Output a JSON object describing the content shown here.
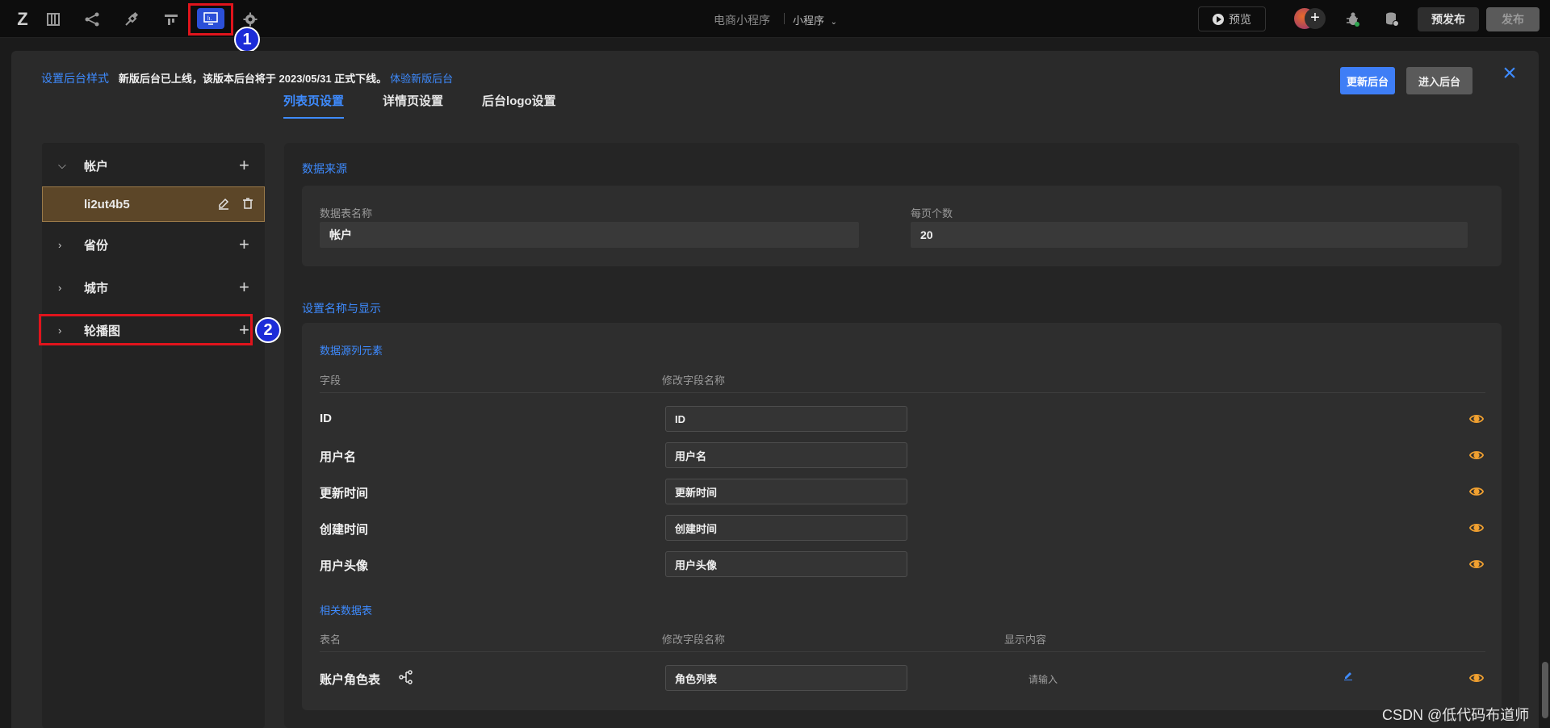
{
  "topbar": {
    "logo": "Z",
    "icons": [
      "table-icon",
      "flow-icon",
      "plugin-icon",
      "layout-icon",
      "admin-icon",
      "gear-icon"
    ],
    "project_name": "电商小程序",
    "app_type": "小程序",
    "preview_label": "预览",
    "pre_publish_label": "预发布",
    "publish_label": "发布",
    "annotation_1": "1",
    "annotation_2": "2"
  },
  "modal": {
    "notice_prefix": "设置后台样式",
    "notice_text": "新版后台已上线，该版本后台将于 2023/05/31 正式下线。",
    "notice_link": "体验新版后台",
    "tabs": [
      {
        "label": "列表页设置"
      },
      {
        "label": "详情页设置"
      },
      {
        "label": "后台logo设置"
      }
    ],
    "update_button": "更新后台",
    "enter_button": "进入后台"
  },
  "tree": {
    "items": [
      {
        "label": "帐户"
      },
      {
        "label": "li2ut4b5"
      },
      {
        "label": "省份"
      },
      {
        "label": "城市"
      },
      {
        "label": "轮播图"
      }
    ]
  },
  "data_source": {
    "title": "数据来源",
    "table_label": "数据表名称",
    "table_value": "帐户",
    "per_page_label": "每页个数",
    "per_page_value": "20"
  },
  "display": {
    "title": "设置名称与显示",
    "elements_title": "数据源列元素",
    "col_field": "字段",
    "col_rename": "修改字段名称",
    "rows": [
      {
        "field": "ID",
        "value": "ID"
      },
      {
        "field": "用户名",
        "value": "用户名"
      },
      {
        "field": "更新时间",
        "value": "更新时间"
      },
      {
        "field": "创建时间",
        "value": "创建时间"
      },
      {
        "field": "用户头像",
        "value": "用户头像"
      }
    ],
    "related_title": "相关数据表",
    "col_table": "表名",
    "col_rename2": "修改字段名称",
    "col_display": "显示内容",
    "related_rows": [
      {
        "table": "账户角色表",
        "value": "角色列表",
        "placeholder": "请输入"
      }
    ]
  },
  "watermark": "CSDN @低代码布道师",
  "colors": {
    "accent": "#3e8bff",
    "annotation_red": "#e0141c",
    "eye": "#f0a030",
    "selected_row": "#5c4628"
  }
}
